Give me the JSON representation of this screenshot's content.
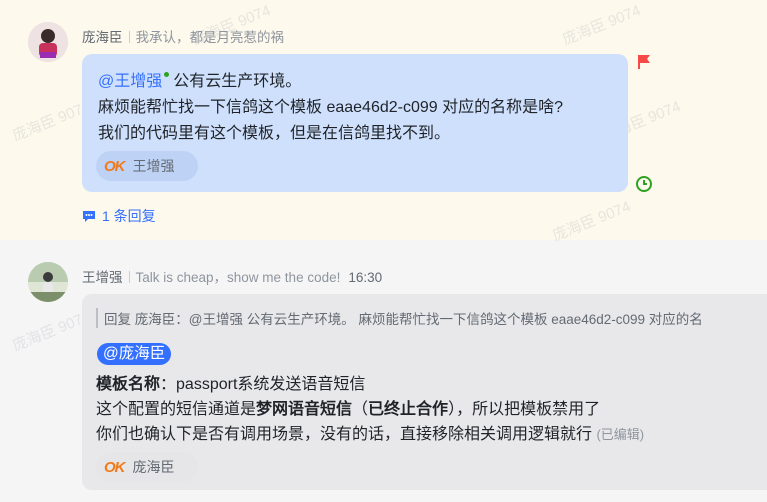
{
  "message1": {
    "sender": "庞海臣",
    "signature": "我承认，都是月亮惹的祸",
    "mention": "@王增强",
    "line1_rest": "公有云生产环境。",
    "line2": "麻烦能帮忙找一下信鸽这个模板 eaae46d2-c099 对应的名称是啥?",
    "line3": "我们的代码里有这个模板，但是在信鸽里找不到。",
    "reaction": {
      "emoji": "OK",
      "user": "王增强"
    },
    "thread_text": "1 条回复"
  },
  "message2": {
    "sender": "王增强",
    "signature": "Talk is cheap，show me the code!",
    "time": "16:30",
    "quote": "回复 庞海臣：@王增强 公有云生产环境。 麻烦能帮忙找一下信鸽这个模板 eaae46d2-c099 对应的名",
    "mention": "@庞海臣",
    "field_label": "模板名称",
    "field_value": "：passport系统发送语音短信",
    "line2_a": "这个配置的短信通道是",
    "line2_b": "梦网语音短信",
    "line2_c": "（",
    "line2_d": "已终止合作",
    "line2_e": "），所以把模板禁用了",
    "line3": "你们也确认下是否有调用场景，没有的话，直接移除相关调用逻辑就行",
    "edited": "(已编辑)",
    "reaction": {
      "emoji": "OK",
      "user": "庞海臣"
    }
  },
  "watermark": "庞海臣 9074",
  "colors": {
    "accent": "#3370ff",
    "flag": "#f54a45",
    "clock": "#2ea121"
  }
}
